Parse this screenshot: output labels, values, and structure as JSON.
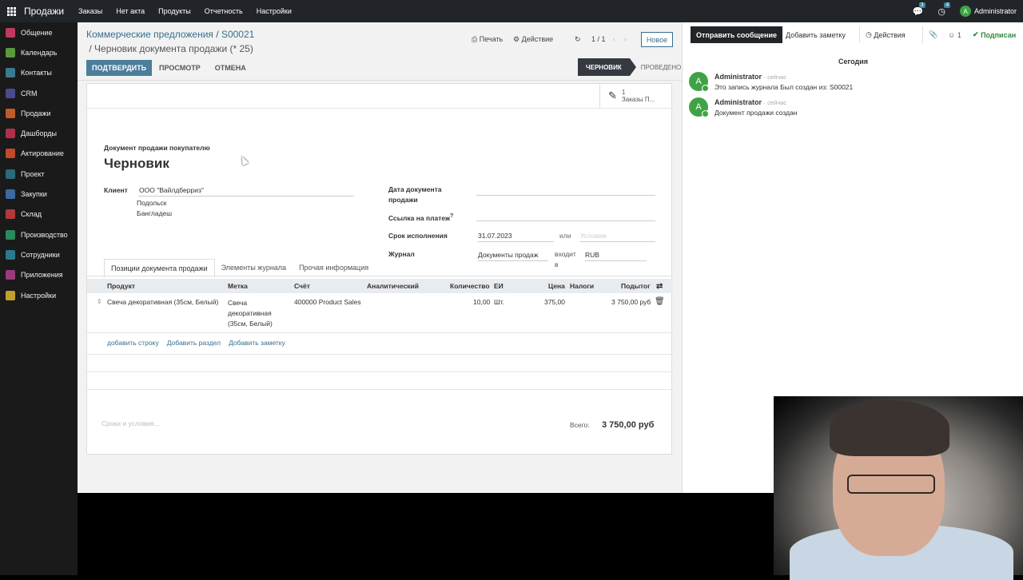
{
  "topbar": {
    "app_name": "Продажи",
    "menu": [
      "Заказы",
      "Нет акта",
      "Продукты",
      "Отчетность",
      "Настройки"
    ],
    "messages_count": "3",
    "activities_count": "4",
    "user_initial": "A",
    "user_name": "Administrator"
  },
  "sidebar": {
    "items": [
      {
        "label": "Общение",
        "color": "#c0395f"
      },
      {
        "label": "Календарь",
        "color": "#5a9a3a"
      },
      {
        "label": "Контакты",
        "color": "#3a7a8f"
      },
      {
        "label": "CRM",
        "color": "#4a4a8f"
      },
      {
        "label": "Продажи",
        "color": "#c05a2a"
      },
      {
        "label": "Дашборды",
        "color": "#b0304a"
      },
      {
        "label": "Актирование",
        "color": "#c04a2a"
      },
      {
        "label": "Проект",
        "color": "#2a6a7a"
      },
      {
        "label": "Закупки",
        "color": "#3a6a9f"
      },
      {
        "label": "Склад",
        "color": "#b03a3a"
      },
      {
        "label": "Производство",
        "color": "#2a8a5a"
      },
      {
        "label": "Сотрудники",
        "color": "#2a7a8f"
      },
      {
        "label": "Приложения",
        "color": "#9a3a7a"
      },
      {
        "label": "Настройки",
        "color": "#c0a02a"
      }
    ]
  },
  "breadcrumb": {
    "parent": "Коммерческие предложения",
    "record": "S00021",
    "current": "Черновик документа продажи (* 25)"
  },
  "controls": {
    "print": "Печать",
    "action": "Действие",
    "pager": "1 / 1",
    "new": "Новое"
  },
  "actions": {
    "confirm": "ПОДТВЕРДИТЬ",
    "preview": "ПРОСМОТР",
    "cancel": "ОТМЕНА"
  },
  "status": {
    "active": "ЧЕРНОВИК",
    "next": "ПРОВЕДЕНО"
  },
  "smart_button": {
    "count": "1",
    "label": "Заказы П..."
  },
  "form": {
    "doc_type": "Документ продажи покупателю",
    "title": "Черновик",
    "client_label": "Клиент",
    "client_name": "ООО \"Вайлдберриз\"",
    "client_city": "Подольск",
    "client_country": "Бангладеш",
    "doc_date_label_1": "Дата документа",
    "doc_date_label_2": "продажи",
    "payment_ref_label": "Ссылка на платеж",
    "payment_ref_hint": "?",
    "due_label": "Срок исполнения",
    "due_value": "31.07.2023",
    "or": "или",
    "terms_placeholder": "Условия",
    "journal_label": "Журнал",
    "journal_value": "Документы продаж",
    "in_label_1": "входит",
    "in_label_2": "в",
    "currency": "RUB"
  },
  "tabs": [
    "Позиции документа продажи",
    "Элементы журнала",
    "Прочая информация"
  ],
  "table": {
    "headers": {
      "product": "Продукт",
      "label": "Метка",
      "account": "Счёт",
      "analytic": "Аналитический",
      "qty": "Количество",
      "uom": "ЕИ",
      "price": "Цена",
      "taxes": "Налоги",
      "subtotal": "Подытог"
    },
    "rows": [
      {
        "product": "Свеча декоративная (35см, Белый)",
        "label_1": "Свеча",
        "label_2": "декоративная",
        "label_3": "(35см, Белый)",
        "account": "400000 Product Sales",
        "qty": "10,00",
        "uom": "Шт.",
        "price": "375,00",
        "subtotal": "3 750,00 руб"
      }
    ],
    "add_line": "добавить строку",
    "add_section": "Добавить раздел",
    "add_note": "Добавить заметку"
  },
  "footer": {
    "terms_placeholder": "Сроки и условия...",
    "total_label": "Всего:",
    "total_value": "3 750,00 руб"
  },
  "chatter": {
    "send_message": "Отправить сообщение",
    "add_note": "Добавить заметку",
    "activities": "Действия",
    "followers_count": "1",
    "subscribed": "Подписан",
    "date_separator": "Сегодия",
    "messages": [
      {
        "initial": "A",
        "author": "Administrator",
        "time": "· сейчас",
        "body": "Это запись журнала Был создан из: S00021"
      },
      {
        "initial": "A",
        "author": "Administrator",
        "time": "· сейчас",
        "body": "Документ продажи создан"
      }
    ]
  }
}
